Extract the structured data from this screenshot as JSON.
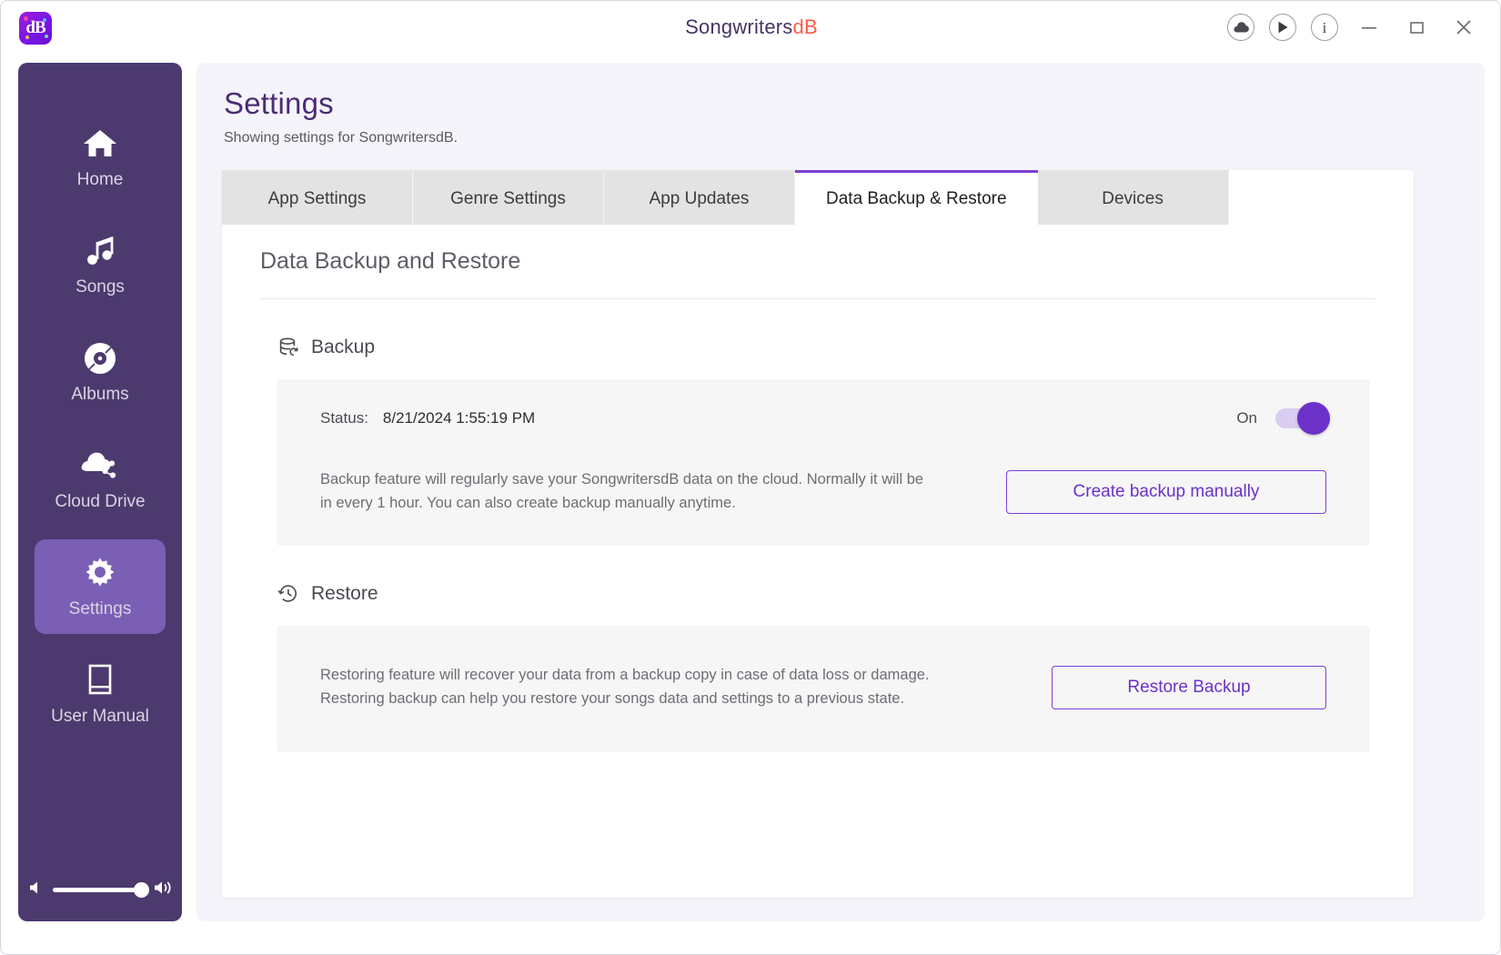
{
  "window": {
    "title_main": "Songwriters",
    "title_accent": "dB",
    "logo_text": "dB",
    "controls": [
      {
        "name": "cloud-icon",
        "label": "Cloud"
      },
      {
        "name": "play-icon",
        "label": "Play"
      },
      {
        "name": "info-icon",
        "label": "Info"
      },
      {
        "name": "minimize-button",
        "label": "Minimize"
      },
      {
        "name": "maximize-button",
        "label": "Maximize"
      },
      {
        "name": "close-button",
        "label": "Close"
      }
    ]
  },
  "sidebar": {
    "items": [
      {
        "label": "Home",
        "icon": "home-icon",
        "active": false
      },
      {
        "label": "Songs",
        "icon": "music-note-icon",
        "active": false
      },
      {
        "label": "Albums",
        "icon": "disc-icon",
        "active": false
      },
      {
        "label": "Cloud Drive",
        "icon": "cloud-share-icon",
        "active": false
      },
      {
        "label": "Settings",
        "icon": "gear-icon",
        "active": true
      },
      {
        "label": "User Manual",
        "icon": "book-icon",
        "active": false
      }
    ],
    "volume": {
      "value": 88,
      "mute_icon": "volume-mute-icon",
      "loud_icon": "volume-up-icon"
    }
  },
  "header": {
    "title": "Settings",
    "subtitle": "Showing settings for SongwritersdB."
  },
  "tabs": [
    {
      "label": "App Settings",
      "active": false
    },
    {
      "label": "Genre Settings",
      "active": false
    },
    {
      "label": "App Updates",
      "active": false
    },
    {
      "label": "Data Backup & Restore",
      "active": true
    },
    {
      "label": "Devices",
      "active": false
    }
  ],
  "content": {
    "section_title": "Data Backup and Restore",
    "backup": {
      "heading": "Backup",
      "icon": "database-backup-icon",
      "status_label": "Status:",
      "status_value": "8/21/2024 1:55:19 PM",
      "toggle_label": "On",
      "toggle_on": true,
      "description_line1": "Backup feature will regularly save your SongwritersdB data on the cloud. Normally it will be",
      "description_line2": "in every 1 hour. You can also create backup manually anytime.",
      "button_label": "Create backup manually"
    },
    "restore": {
      "heading": "Restore",
      "icon": "history-clock-icon",
      "description_line1": "Restoring feature will recover your data from a backup copy in case of data loss or damage.",
      "description_line2": "Restoring backup can help you restore your songs data and settings to a previous state.",
      "button_label": "Restore Backup"
    }
  },
  "colors": {
    "accent_purple": "#6c31c9",
    "sidebar": "#4c3a6e",
    "sidebar_active": "#7b5fb5",
    "title_accent": "#fc5a4b",
    "page_title": "#4b2c74"
  }
}
